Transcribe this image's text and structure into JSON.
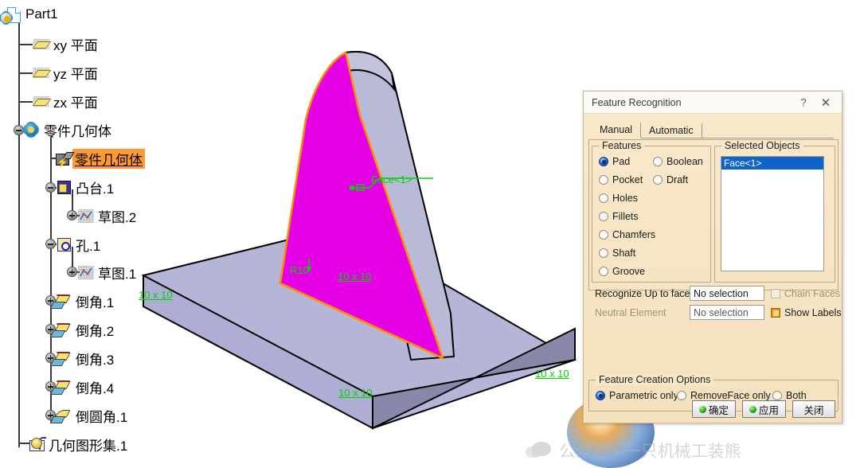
{
  "app": {
    "tree_root": "Part1"
  },
  "tree": {
    "items": [
      {
        "label": "Part1",
        "icon": "part-document-icon"
      },
      {
        "label": "xy 平面",
        "icon": "plane-icon"
      },
      {
        "label": "yz 平面",
        "icon": "plane-icon"
      },
      {
        "label": "zx 平面",
        "icon": "plane-icon"
      },
      {
        "label": "零件几何体",
        "icon": "partbody-gear-icon"
      },
      {
        "label": "零件几何体",
        "icon": "solid-body-icon",
        "selected": true
      },
      {
        "label": "凸台.1",
        "icon": "pad-icon"
      },
      {
        "label": "草图.2",
        "icon": "sketch-icon"
      },
      {
        "label": "孔.1",
        "icon": "hole-icon"
      },
      {
        "label": "草图.1",
        "icon": "sketch-icon"
      },
      {
        "label": "倒角.1",
        "icon": "chamfer-icon"
      },
      {
        "label": "倒角.2",
        "icon": "chamfer-icon"
      },
      {
        "label": "倒角.3",
        "icon": "chamfer-icon"
      },
      {
        "label": "倒角.4",
        "icon": "chamfer-icon"
      },
      {
        "label": "倒圆角.1",
        "icon": "fillet-icon"
      },
      {
        "label": "几何图形集.1",
        "icon": "geometrical-set-icon"
      }
    ]
  },
  "viewport": {
    "face_label": "Face<1>",
    "radius_label": "R10",
    "dimension_labels": [
      "10 x 10",
      "10 x 10",
      "10 x 10",
      "10 x 10",
      "10 x 10"
    ],
    "colors": {
      "selected_face": "#e600e6",
      "selected_edge": "#ff8c00",
      "solid_face": "#b5b5d8",
      "solid_face_dark": "#8888aa",
      "label_green": "#00d400"
    }
  },
  "dialog": {
    "title": "Feature Recognition",
    "help_button": "?",
    "close_button": "✕",
    "tabs": [
      {
        "label": "Manual",
        "active": true
      },
      {
        "label": "Automatic",
        "active": false
      }
    ],
    "features_group": {
      "title": "Features",
      "options": [
        {
          "label": "Pad",
          "selected": true
        },
        {
          "label": "Boolean",
          "selected": false
        },
        {
          "label": "Pocket",
          "selected": false
        },
        {
          "label": "Draft",
          "selected": false
        },
        {
          "label": "Holes",
          "selected": false
        },
        {
          "label": "Fillets",
          "selected": false
        },
        {
          "label": "Chamfers",
          "selected": false
        },
        {
          "label": "Shaft",
          "selected": false
        },
        {
          "label": "Groove",
          "selected": false
        }
      ]
    },
    "selected_objects_group": {
      "title": "Selected Objects",
      "items": [
        "Face<1>"
      ]
    },
    "recognize_up_to_face": {
      "label": "Recognize Up to face",
      "value": "No selection",
      "checkbox_label": "Chain Faces",
      "checkbox_checked": false,
      "checkbox_enabled": false
    },
    "neutral_element": {
      "label": "Neutral Element",
      "value": "No selection",
      "enabled": false,
      "checkbox_label": "Show Labels",
      "checkbox_checked": true
    },
    "creation_options": {
      "title": "Feature Creation Options",
      "options": [
        {
          "label": "Parametric only",
          "selected": true
        },
        {
          "label": "RemoveFace only",
          "selected": false
        },
        {
          "label": "Both",
          "selected": false
        }
      ]
    },
    "buttons": [
      {
        "label": "确定",
        "has_icon": true
      },
      {
        "label": "应用",
        "has_icon": true
      },
      {
        "label": "关闭",
        "has_icon": false
      }
    ]
  },
  "watermark": {
    "text": "公众号 · 一只机械工装熊",
    "icon": "wechat-icon"
  }
}
